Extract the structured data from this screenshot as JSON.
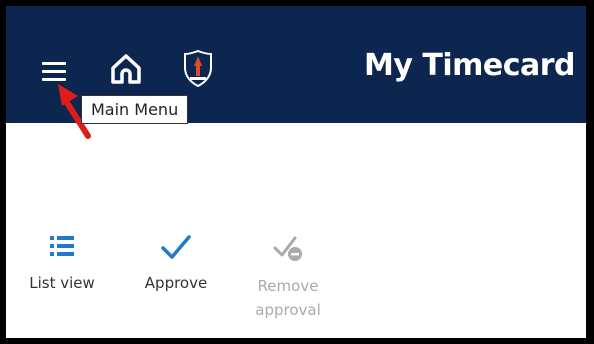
{
  "header": {
    "title": "My Timecard",
    "logo_text": "",
    "background_color": "#0c2650",
    "menu_icon": "hamburger-icon",
    "home_icon": "home-icon"
  },
  "tooltip": {
    "label": "Main Menu"
  },
  "toolbar": {
    "items": [
      {
        "label": "List view",
        "icon": "list-icon",
        "enabled": true
      },
      {
        "label": "Approve",
        "icon": "checkmark-icon",
        "enabled": true
      },
      {
        "label": "Remove approval",
        "icon": "remove-approval-icon",
        "enabled": false
      }
    ],
    "accent_color": "#1f7acb",
    "disabled_color": "#aaaaaa"
  },
  "annotation": {
    "arrow_color": "#e01b1b"
  }
}
